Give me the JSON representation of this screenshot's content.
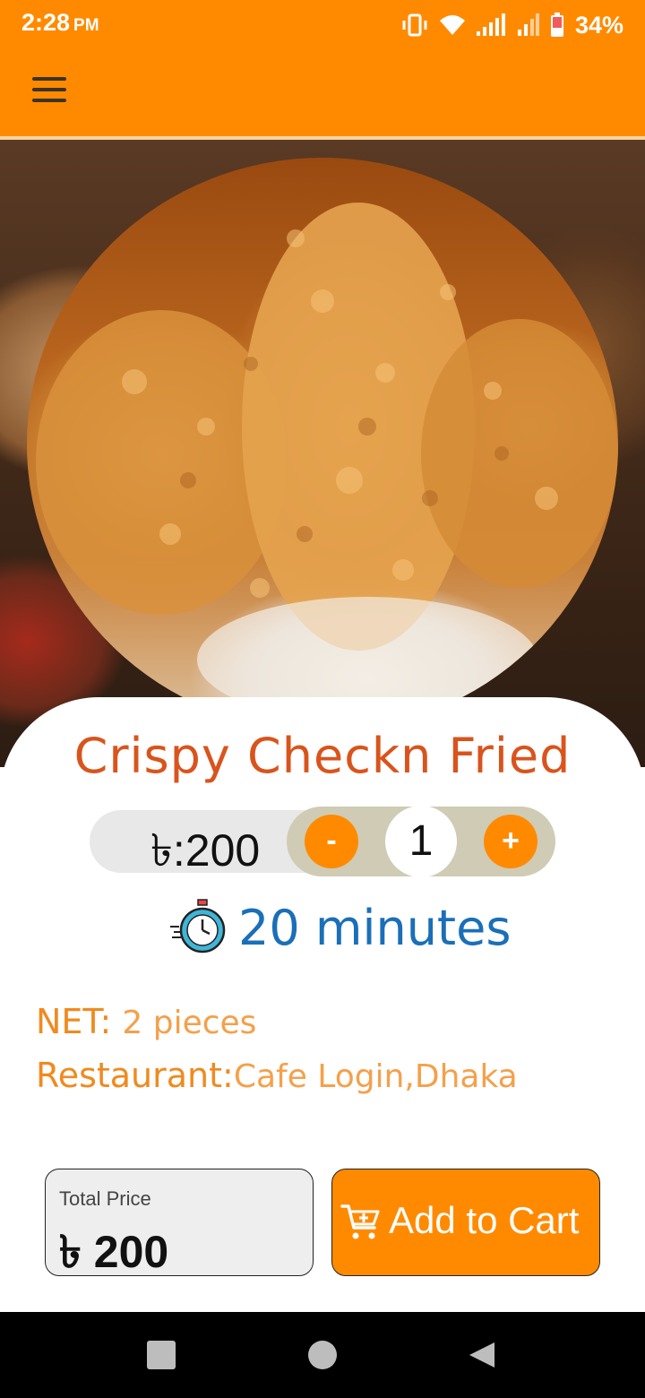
{
  "status_bar": {
    "time": "2:28",
    "ampm": "PM",
    "battery": "34%",
    "icons": [
      "vibrate-icon",
      "wifi-icon",
      "signal-icon",
      "signal-icon-2",
      "battery-icon"
    ]
  },
  "app_bar": {
    "menu_icon": "hamburger-menu-icon"
  },
  "hero": {
    "image": "fried-chicken-photo"
  },
  "product": {
    "title": "Crispy Checkn Fried",
    "price": "৳:200",
    "quantity": "1",
    "minus_label": "-",
    "plus_label": "+",
    "time": "20 minutes",
    "net_label": "NET:",
    "net_value": "2 pieces",
    "restaurant_label": "Restaurant:",
    "restaurant_value": "Cafe Login,Dhaka"
  },
  "footer": {
    "total_label": "Total Price",
    "total_value": "৳ 200",
    "cart_label": "Add to Cart"
  },
  "colors": {
    "primary": "#ff8a00",
    "title": "#d9541c",
    "time_text": "#1a6fb8"
  },
  "navbar": {
    "icons": [
      "recents-square-icon",
      "home-circle-icon",
      "back-triangle-icon"
    ]
  }
}
